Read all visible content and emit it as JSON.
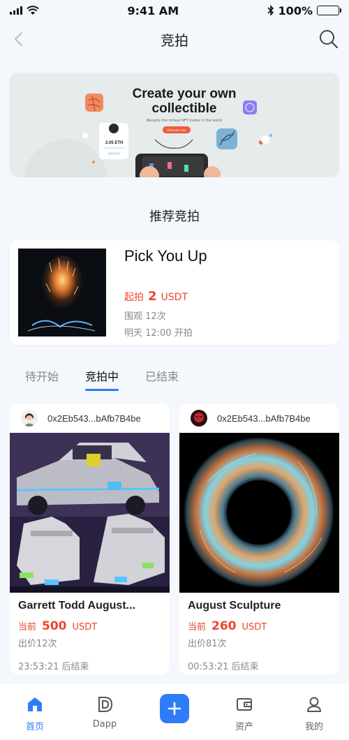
{
  "status_bar": {
    "time": "9:41 AM",
    "battery": "100%"
  },
  "nav": {
    "title": "竞拍"
  },
  "banner": {
    "title_line1": "Create your own",
    "title_line2": "collectible",
    "subtitle": "Become the richest NFT trader in the world",
    "button": "Discover now",
    "eth_value": "2.05 ETH"
  },
  "section": {
    "title": "推荐竞拍"
  },
  "featured": {
    "name": "Pick You Up",
    "price_label": "起拍",
    "price_value": "2",
    "price_unit": "USDT",
    "views": "围观 12次",
    "start_time": "明天 12:00 开拍"
  },
  "tabs": [
    {
      "label": "待开始"
    },
    {
      "label": "竞拍中"
    },
    {
      "label": "已结束"
    }
  ],
  "cards": [
    {
      "owner": "0x2Eb543...bAfb7B4be",
      "title": "Garrett Todd August...",
      "price_label": "当前",
      "price_value": "500",
      "price_unit": "USDT",
      "bids": "出价12次",
      "ends": "23:53:21 后结束"
    },
    {
      "owner": "0x2Eb543...bAfb7B4be",
      "title": "August Sculpture",
      "price_label": "当前",
      "price_value": "260",
      "price_unit": "USDT",
      "bids": "出价81次",
      "ends": "00:53:21 后结束"
    }
  ],
  "tab_bar": [
    {
      "label": "首页",
      "icon": "home-icon"
    },
    {
      "label": "Dapp",
      "icon": "dapp-icon"
    },
    {
      "label": "",
      "icon": "plus-icon"
    },
    {
      "label": "资产",
      "icon": "wallet-icon"
    },
    {
      "label": "我的",
      "icon": "user-icon"
    }
  ],
  "colors": {
    "accent": "#2f7cf6",
    "price": "#f0442c",
    "background": "#f4f7fc"
  }
}
